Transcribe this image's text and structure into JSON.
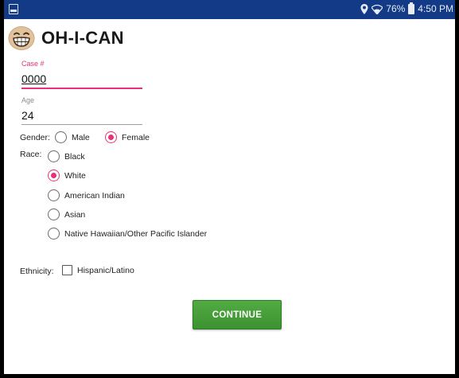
{
  "status_bar": {
    "battery": "76%",
    "time": "4:50 PM",
    "icons": [
      "notification-icon",
      "location-icon",
      "wifi-icon",
      "battery-icon"
    ]
  },
  "app": {
    "title": "OH-I-CAN",
    "logo_icon": "grinning-face-emoji",
    "logo_glyph": "😁"
  },
  "form": {
    "case": {
      "label": "Case #",
      "value": "0000"
    },
    "age": {
      "label": "Age",
      "value": "24"
    },
    "gender": {
      "label": "Gender:",
      "options": [
        "Male",
        "Female"
      ],
      "selected": "Female"
    },
    "race": {
      "label": "Race:",
      "options": [
        "Black",
        "White",
        "American Indian",
        "Asian",
        "Native Hawaiian/Other Pacific Islander"
      ],
      "selected": "White"
    },
    "ethnicity": {
      "label": "Ethnicity:",
      "option": "Hispanic/Latino",
      "checked": false
    },
    "continue_label": "CONTINUE"
  },
  "colors": {
    "status_bar": "#123a86",
    "accent": "#e53278",
    "button": "#47a23a"
  }
}
